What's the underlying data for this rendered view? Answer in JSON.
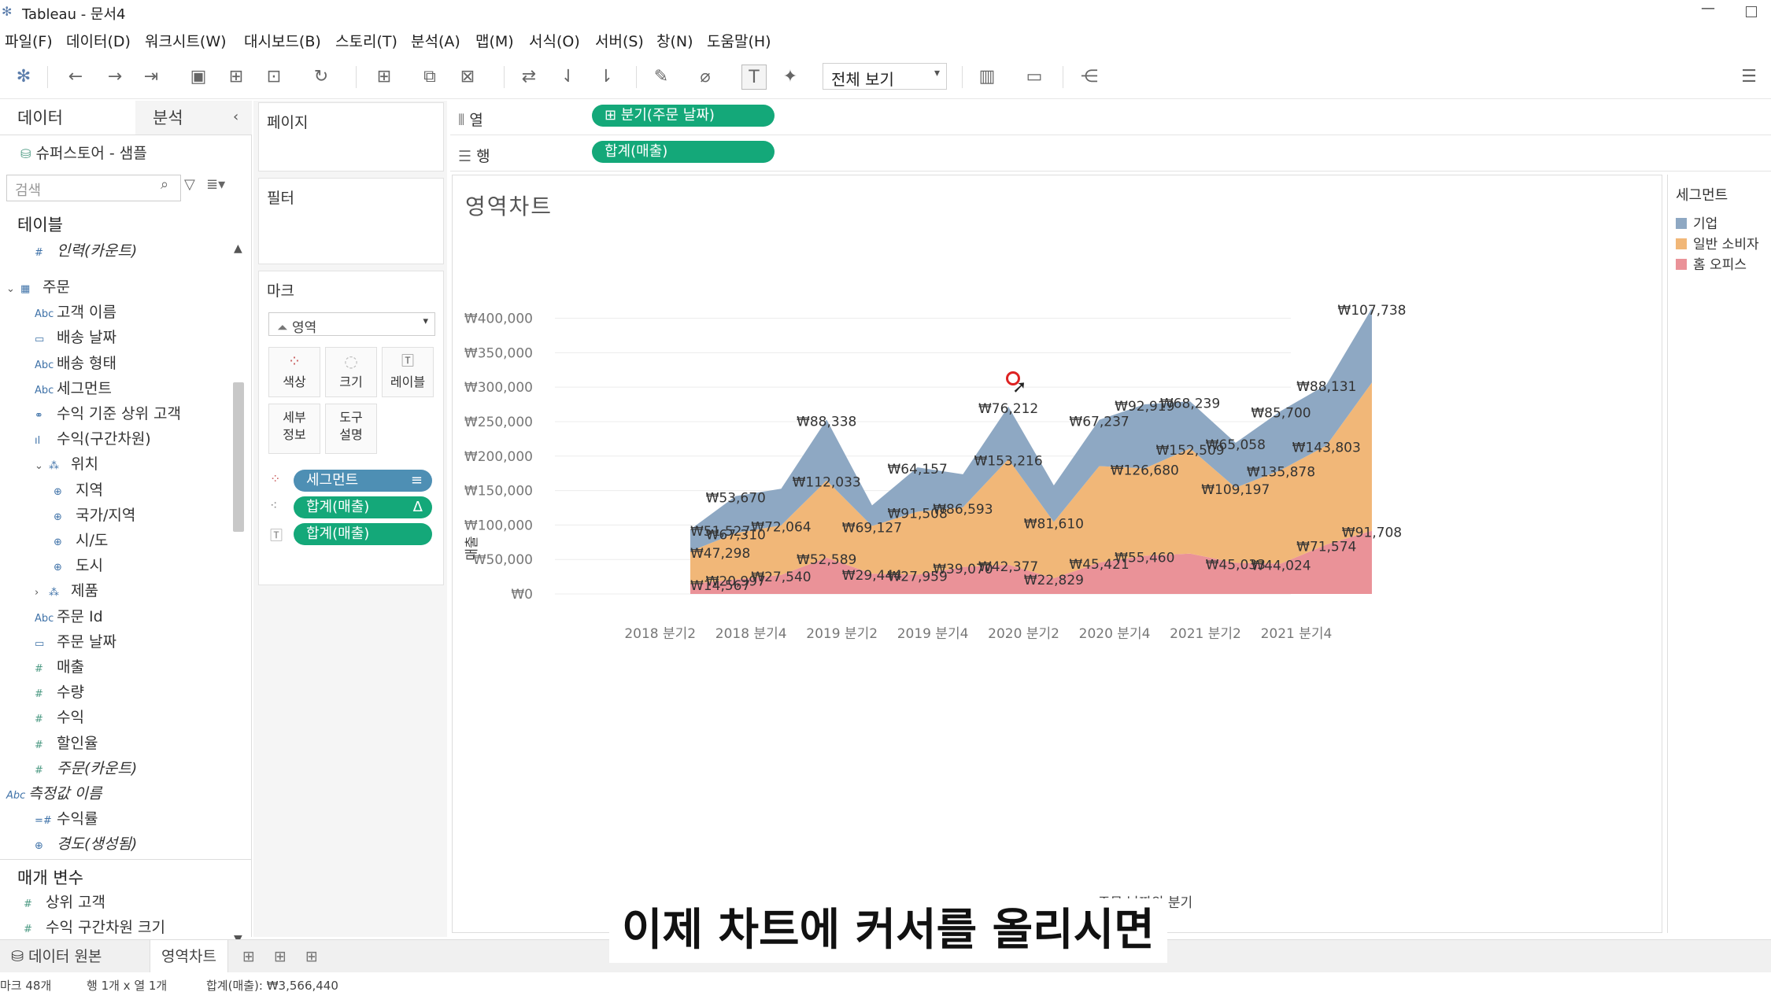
{
  "window": {
    "title": "Tableau - 문서4"
  },
  "menu": [
    "파일(F)",
    "데이터(D)",
    "워크시트(W)",
    "대시보드(B)",
    "스토리(T)",
    "분석(A)",
    "맵(M)",
    "서식(O)",
    "서버(S)",
    "창(N)",
    "도움말(H)"
  ],
  "toolbar": {
    "view_select": "전체 보기"
  },
  "side": {
    "tab_data": "데이터",
    "tab_analysis": "분석",
    "datasource": "슈퍼스토어 - 샘플",
    "search_placeholder": "검색",
    "tables_header": "테이블",
    "fields": [
      {
        "label": "인력(카운트)",
        "icon": "#",
        "italic": true,
        "indent": 1
      },
      {
        "label": "주문",
        "icon": "▦",
        "italic": false,
        "indent": 0,
        "group": true
      },
      {
        "label": "고객 이름",
        "icon": "Abc",
        "italic": false,
        "indent": 1
      },
      {
        "label": "배송 날짜",
        "icon": "▭",
        "italic": false,
        "indent": 1
      },
      {
        "label": "배송 형태",
        "icon": "Abc",
        "italic": false,
        "indent": 1
      },
      {
        "label": "세그먼트",
        "icon": "Abc",
        "italic": false,
        "indent": 1
      },
      {
        "label": "수익 기준 상위 고객",
        "icon": "⚭",
        "italic": false,
        "indent": 1
      },
      {
        "label": "수익(구간차원)",
        "icon": "ıl",
        "italic": false,
        "indent": 1
      },
      {
        "label": "위치",
        "icon": "⁂",
        "italic": false,
        "indent": 1,
        "group": true
      },
      {
        "label": "지역",
        "icon": "⊕",
        "italic": false,
        "indent": 2
      },
      {
        "label": "국가/지역",
        "icon": "⊕",
        "italic": false,
        "indent": 2
      },
      {
        "label": "시/도",
        "icon": "⊕",
        "italic": false,
        "indent": 2
      },
      {
        "label": "도시",
        "icon": "⊕",
        "italic": false,
        "indent": 2
      },
      {
        "label": "제품",
        "icon": "⁂",
        "italic": false,
        "indent": 1,
        "group": true
      },
      {
        "label": "주문 Id",
        "icon": "Abc",
        "italic": false,
        "indent": 1
      },
      {
        "label": "주문 날짜",
        "icon": "▭",
        "italic": false,
        "indent": 1
      },
      {
        "label": "매출",
        "icon": "#",
        "italic": false,
        "indent": 1
      },
      {
        "label": "수량",
        "icon": "#",
        "italic": false,
        "indent": 1
      },
      {
        "label": "수익",
        "icon": "#",
        "italic": false,
        "indent": 1
      },
      {
        "label": "할인율",
        "icon": "#",
        "italic": false,
        "indent": 1
      },
      {
        "label": "주문(카운트)",
        "icon": "#",
        "italic": true,
        "indent": 1
      },
      {
        "label": "측정값 이름",
        "icon": "Abc",
        "italic": true,
        "indent": 0
      },
      {
        "label": "수익률",
        "icon": "=#",
        "italic": false,
        "indent": 1
      },
      {
        "label": "경도(생성됨)",
        "icon": "⊕",
        "italic": true,
        "indent": 1
      }
    ],
    "params_header": "매개 변수",
    "params": [
      {
        "label": "상위 고객",
        "icon": "#"
      },
      {
        "label": "수익 구간차원 크기",
        "icon": "#"
      }
    ]
  },
  "shelves": {
    "pages": "페이지",
    "filters": "필터",
    "marks": "마크",
    "mark_type": "영역",
    "mark_buttons": [
      {
        "label": "색상",
        "icon": "⁘"
      },
      {
        "label": "크기",
        "icon": "◌"
      },
      {
        "label": "레이블",
        "icon": "T"
      },
      {
        "label": "세부\n정보",
        "icon": ""
      },
      {
        "label": "도구\n설명",
        "icon": ""
      }
    ],
    "mark_pills": [
      {
        "label": "세그먼트",
        "color": "blue",
        "tail": "≡"
      },
      {
        "label": "합계(매출)",
        "color": "green",
        "tail": "Δ"
      },
      {
        "label": "합계(매출)",
        "color": "green",
        "tail": ""
      }
    ],
    "columns_label": "열",
    "columns_pill": "⊞ 분기(주문 날짜)",
    "rows_label": "행",
    "rows_pill": "합계(매출)"
  },
  "viz": {
    "title": "영역차트"
  },
  "legend": {
    "title": "세그먼트",
    "items": [
      {
        "label": "기업",
        "color": "#8ea8c3"
      },
      {
        "label": "일반 소비자",
        "color": "#f1b778"
      },
      {
        "label": "홈 오피스",
        "color": "#ea9298"
      }
    ]
  },
  "chart_data": {
    "type": "area",
    "stacked": true,
    "title": "영역차트",
    "ylabel": "매출",
    "xlabel": "주문 날짜의 분기",
    "ylim": [
      0,
      420000
    ],
    "y_ticks": [
      "₩0",
      "₩50,000",
      "₩100,000",
      "₩150,000",
      "₩200,000",
      "₩250,000",
      "₩300,000",
      "₩350,000",
      "₩400,000"
    ],
    "x_tick_labels": [
      "2018 분기2",
      "2018 분기4",
      "2019 분기2",
      "2019 분기4",
      "2020 분기2",
      "2020 분기4",
      "2021 분기2",
      "2021 분기4"
    ],
    "categories": [
      "2018 Q1",
      "2018 Q2",
      "2018 Q3",
      "2018 Q4",
      "2019 Q1",
      "2019 Q2",
      "2019 Q3",
      "2019 Q4",
      "2020 Q1",
      "2020 Q2",
      "2020 Q3",
      "2020 Q4",
      "2021 Q1",
      "2021 Q2",
      "2021 Q3",
      "2021 Q4"
    ],
    "series": [
      {
        "name": "홈 오피스",
        "color": "#ea9298",
        "values": [
          14567,
          20997,
          27540,
          52589,
          29444,
          27959,
          39070,
          42377,
          22829,
          45421,
          55460,
          58500,
          45033,
          44024,
          71574,
          91708
        ],
        "labels": [
          "₩14,567",
          "₩20,997",
          "₩27,540",
          "₩52,589",
          "₩29,444",
          "₩27,959",
          "₩39,070",
          "₩42,377",
          "₩22,829",
          "₩45,421",
          "₩55,460",
          "",
          "₩45,033",
          "₩44,024",
          "₩71,574",
          "₩91,708"
        ]
      },
      {
        "name": "일반 소비자",
        "color": "#f1b778",
        "values": [
          47298,
          67310,
          72064,
          112033,
          69127,
          91508,
          86593,
          153216,
          81610,
          140000,
          126680,
          152509,
          109197,
          135878,
          143803,
          215000
        ],
        "labels": [
          "₩47,298",
          "₩67,310",
          "₩72,064",
          "₩112,033",
          "₩69,127",
          "₩91,508",
          "₩86,593",
          "₩153,216",
          "₩81,610",
          "",
          "₩126,680",
          "₩152,509",
          "₩109,197",
          "₩135,878",
          "₩143,803",
          ""
        ]
      },
      {
        "name": "기업",
        "color": "#8ea8c3",
        "values": [
          31600,
          53670,
          53000,
          88338,
          30000,
          64157,
          48000,
          76212,
          53000,
          67237,
          92919,
          68239,
          65058,
          85700,
          88131,
          107738
        ],
        "labels": [
          "₩51,527",
          "₩53,670",
          "",
          "₩88,338",
          "",
          "₩64,157",
          "",
          "₩76,212",
          "",
          "₩67,237",
          "₩92,919",
          "₩68,239",
          "₩65,058",
          "₩85,700",
          "₩88,131",
          "₩107,738"
        ]
      }
    ]
  },
  "bottom": {
    "datasource_tab": "데이터 원본",
    "sheet_tab": "영역차트"
  },
  "status": {
    "marks": "마크 48개",
    "rows_cols": "행 1개 x 열 1개",
    "sum": "합계(매출): ₩3,566,440"
  },
  "subtitle": "이제 차트에 커서를 올리시면"
}
